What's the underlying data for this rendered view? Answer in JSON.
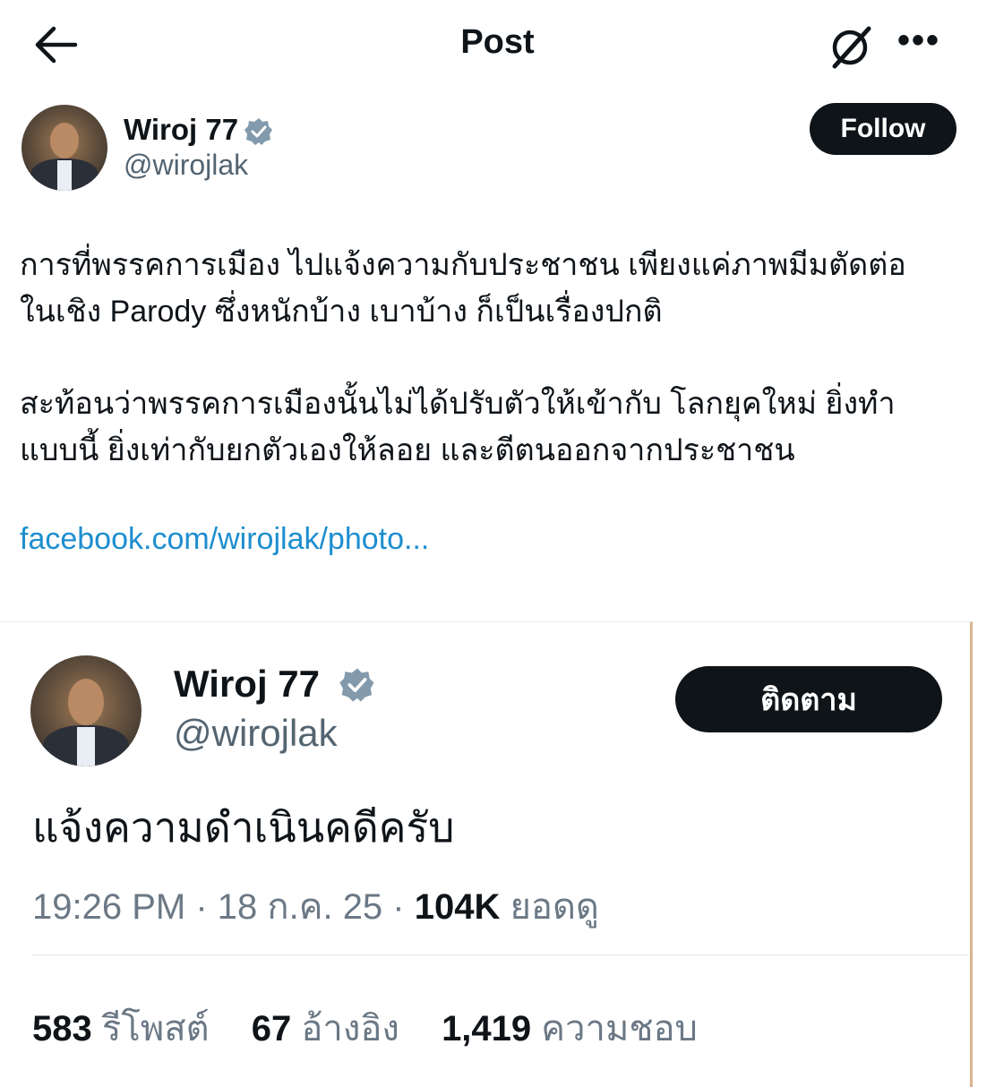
{
  "header": {
    "title": "Post",
    "back_icon": "arrow-left-icon",
    "grok_icon": "grok-icon",
    "more_label": "•••"
  },
  "author": {
    "name": "Wiroj 77",
    "handle": "@wirojlak",
    "verified": true,
    "follow_label": "Follow"
  },
  "post": {
    "lines": [
      "การที่พรรคการเมือง ไปแจ้งความกับประชาชน เพียงแค่ภาพมีมตัดต่อ",
      "ในเชิง Parody ซึ่งหนักบ้าง เบาบ้าง ก็เป็นเรื่องปกติ",
      "สะท้อนว่าพรรคการเมืองนั้นไม่ได้ปรับตัวให้เข้ากับ โลกยุคใหม่ ยิ่งทำ",
      "แบบนี้ ยิ่งเท่ากับยกตัวเองให้ลอย และตีตนออกจากประชาชน"
    ],
    "link": "facebook.com/wirojlak/photo..."
  },
  "quoted": {
    "name": "Wiroj 77",
    "handle": "@wirojlak",
    "follow_label": "ติดตาม",
    "text": "แจ้งความดำเนินคดีครับ",
    "time": "19:26 PM",
    "date": "18 ก.ค. 25",
    "views_count": "104K",
    "views_label": "ยอดดู",
    "reposts_count": "583",
    "reposts_label": "รีโพสต์",
    "quotes_count": "67",
    "quotes_label": "อ้างอิง",
    "likes_count": "1,419",
    "likes_label": "ความชอบ"
  },
  "colors": {
    "text": "#0f1419",
    "muted": "#536471",
    "link": "#1d8ecf",
    "verified": "#829aab",
    "button": "#0f1419"
  }
}
